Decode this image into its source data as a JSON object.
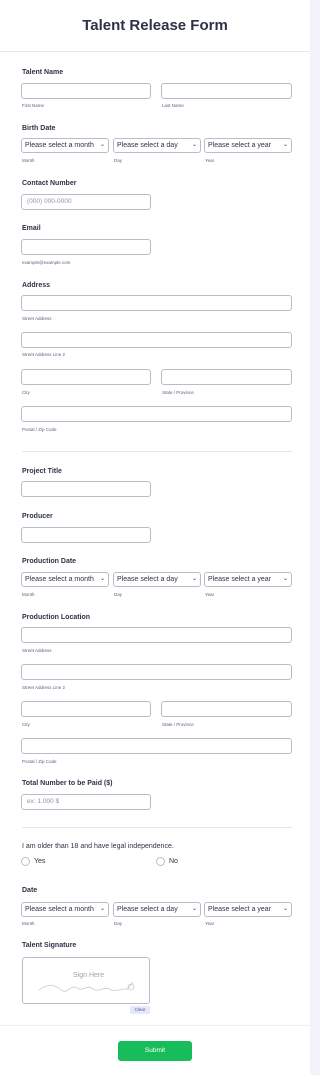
{
  "form_title": "Talent Release Form",
  "talent_name": {
    "label": "Talent Name",
    "first_sub": "First Name",
    "last_sub": "Last Name"
  },
  "birth_date": {
    "label": "Birth Date",
    "month": "Please select a month",
    "day": "Please select a day",
    "year": "Please select a year",
    "month_sub": "Month",
    "day_sub": "Day",
    "year_sub": "Year"
  },
  "contact": {
    "label": "Contact Number",
    "placeholder": "(000) 000-0000"
  },
  "email": {
    "label": "Email",
    "sub": "example@example.com"
  },
  "address": {
    "label": "Address",
    "street": "Street Address",
    "street2": "Street Address Line 2",
    "city": "City",
    "state": "State / Province",
    "postal": "Postal / Zip Code"
  },
  "project_title": {
    "label": "Project Title"
  },
  "producer": {
    "label": "Producer"
  },
  "production_date": {
    "label": "Production Date",
    "month": "Please select a month",
    "day": "Please select a day",
    "year": "Please select a year",
    "month_sub": "Month",
    "day_sub": "Day",
    "year_sub": "Year"
  },
  "production_location": {
    "label": "Production Location",
    "street": "Street Address",
    "street2": "Street Address Line 2",
    "city": "City",
    "state": "State / Province",
    "postal": "Postal / Zip Code"
  },
  "total_paid": {
    "label": "Total Number to be Paid ($)",
    "placeholder": "ex: 1.000 $"
  },
  "age_question": {
    "label": "I am older than 18 and have legal independence.",
    "yes": "Yes",
    "no": "No"
  },
  "date": {
    "label": "Date",
    "month": "Please select a month",
    "day": "Please select a day",
    "year": "Please select a year",
    "month_sub": "Month",
    "day_sub": "Day",
    "year_sub": "Year"
  },
  "signature": {
    "label": "Talent Signature",
    "placeholder": "Sign Here",
    "clear": "Clear"
  },
  "submit": "Submit",
  "colors": {
    "submit": "#18bd5b",
    "text": "#2c3345",
    "border": "#b8bdc9"
  }
}
